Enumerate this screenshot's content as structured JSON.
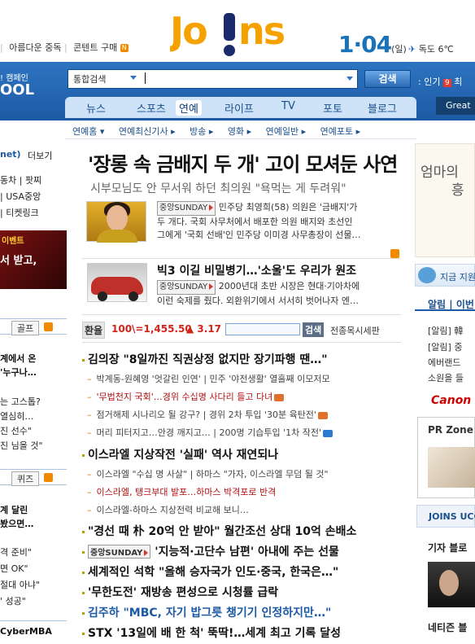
{
  "top_links": [
    "아름다운 중독",
    "콘텐트 구매"
  ],
  "logo": {
    "text": "Jo!ns"
  },
  "date": {
    "day_number": "1·04",
    "weekday": "(일)"
  },
  "weather": {
    "city_temp": "독도 6℃"
  },
  "band": {
    "left_small": "! 캠페인",
    "left_big": "OOL"
  },
  "search": {
    "category": "통합검색",
    "button_label": "검색",
    "popular_label": "인기",
    "popular_rank": "9",
    "popular_suffix": "최"
  },
  "nav_tabs": [
    "뉴스",
    "스포츠",
    "연예",
    "라이프",
    "TV",
    "포토",
    "블로그"
  ],
  "great_label": "Great",
  "sub_nav": [
    "연예홈 ▾",
    "연예최신기사 ▸",
    "방송 ▸",
    "영화 ▸",
    "연예일반 ▸",
    "연예포토 ▸"
  ],
  "left_col": {
    "header": "net)",
    "more": "더보기",
    "links": [
      "동차 | 팟찌",
      "| USA중앙",
      "| 티켓링크"
    ],
    "ad_small": "이벤트",
    "ad_text": "서 받고,",
    "tab1_label": "골프",
    "golf_items": [
      "계에서 온",
      "'누구나…",
      "는 고스톱?",
      "열심히…",
      "진 선수\"",
      "진 님을 것\""
    ],
    "tab2_label": "퀴즈",
    "quiz_items": [
      "계 달린",
      "봤으면…",
      "격 준비\"",
      "면 OK\"",
      "절대 아냐\"",
      "' 성공\""
    ],
    "bottom": "CyberMBA"
  },
  "headline": "'장롱 속 금배지 두 개' 고이 모셔둔 사연",
  "subhead": "시부모님도 안 무서워 하던 최의원 \"욕먹는 게 두려워\"",
  "story1": {
    "source": "중앙SUNDAY",
    "line1": "민주당 최영희(58) 의원은 '금배지'가",
    "line2": "두 개다. 국회 사무처에서 배포한 의원 배지와 초선인",
    "line3": "그에게 '국회 선배'인 민주당 이미경 사무총장이 선물…"
  },
  "story2": {
    "title": "빅3 이길 비밀병기…'소울'도 우리가 원조",
    "source": "중앙SUNDAY",
    "line1": "2000년대 초반 시장은 현대·기아차에",
    "line2": "이런 숙제를 줬다. 외환위기에서 서서히 벗어나자 엔…"
  },
  "fx": {
    "label": "환율",
    "value": "100\\=1,455.50",
    "change": "▲ 3.17",
    "button": "검색",
    "link": "전종목시세판"
  },
  "news": [
    {
      "type": "title",
      "text": "김의장 \"8일까진 직권상정 없지만 장기파행 땐…\""
    },
    {
      "type": "sub",
      "text": "박계동-원혜영 '엇갈린 인연' | 민주 '야전생활' 열흘째 이모저모"
    },
    {
      "type": "sub-red",
      "text": "'무법천지 국회'…경위 수십명 사다리 들고 다녀"
    },
    {
      "type": "sub",
      "text": "점거해제 시나리오 될 강구? | 경위 2차 투입 '30분 육탄전'"
    },
    {
      "type": "sub",
      "text": "머리 피터지고…안경 깨지고… | 200명 기습투입 '1차 작전'"
    },
    {
      "type": "title",
      "text": "이스라엘 지상작전 '실패' 역사 재연되나"
    },
    {
      "type": "sub",
      "text": "이스라엘 \"수십 명 사살\" | 하마스 \"가자, 이스라엘 무덤 될 것\""
    },
    {
      "type": "sub-red",
      "text": "이스라엘, 탱크부대 발포…하마스 박격포로 반격"
    },
    {
      "type": "sub",
      "text": "이스라엘-하마스 지상전력 비교해 보니…"
    },
    {
      "type": "title",
      "text": "\"경선 때 朴 20억 안 받아\" 월간조선 상대 10억 손배소"
    },
    {
      "type": "title",
      "text": "'지능적·고단수 남편' 아내에 주는 선물",
      "source": "중앙SUNDAY"
    },
    {
      "type": "title",
      "text": "세계적인 석학 \"올해 승자국가 인도·중국, 한국은…\""
    },
    {
      "type": "title",
      "text": "'무한도전' 재방송 편성으로 시청률 급락"
    },
    {
      "type": "title-blue",
      "text": "김주하 \"MBC, 자기 밥그릇 챙기기 인정하지만…\""
    },
    {
      "type": "title",
      "text": "STX '13일에 배 한 척' 뚝딱!…세계 최고 기록 달성"
    }
  ],
  "right_col": {
    "ad_text_line1": "엄마의",
    "ad_text_line2": "흥",
    "banner": "지금 지원",
    "tabs": "알림 | 이번",
    "alerts": [
      "[알림] 韓",
      "[알림] 중",
      "에버랜드",
      "소원을 들"
    ],
    "canon": "Canon",
    "pr_zone": "PR Zone",
    "ucc": "JOINS UCC",
    "blog": "기자 블로",
    "netizen": "네티즌 블"
  },
  "colors": {
    "brand_blue": "#1d5aa5",
    "logo_orange": "#f5a200",
    "logo_navy": "#1a2a6c",
    "accent_red": "#d2251a"
  }
}
